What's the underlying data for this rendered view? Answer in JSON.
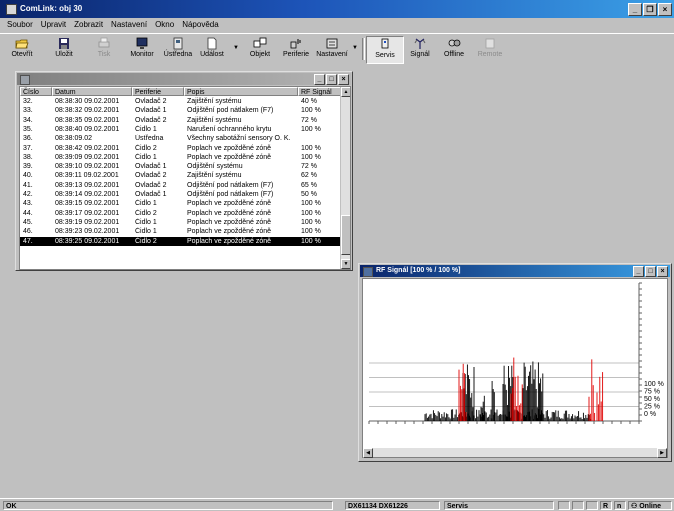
{
  "app": {
    "title": "ComLink: obj 30"
  },
  "menu": [
    "Soubor",
    "Upravit",
    "Zobrazit",
    "Nastavení",
    "Okno",
    "Nápověda"
  ],
  "toolbar": [
    {
      "label": "Otevřít",
      "icon": "folder-open-icon",
      "disabled": false
    },
    {
      "label": "Uložit",
      "icon": "floppy-disk-icon",
      "disabled": false
    },
    {
      "label": "Tisk",
      "icon": "printer-icon",
      "disabled": true
    },
    {
      "label": "Monitor",
      "icon": "monitor-icon",
      "disabled": false
    },
    {
      "label": "Ústředna",
      "icon": "control-panel-icon",
      "disabled": false
    },
    {
      "label": "Událost",
      "icon": "event-document-icon",
      "disabled": false
    },
    {
      "label": "Objekt",
      "icon": "object-icon",
      "disabled": false
    },
    {
      "label": "Periferie",
      "icon": "peripherals-icon",
      "disabled": false
    },
    {
      "label": "Nastavení",
      "icon": "settings-icon",
      "disabled": false
    },
    {
      "label": "Servis",
      "icon": "service-icon",
      "disabled": false,
      "pressed": true
    },
    {
      "label": "Signál",
      "icon": "antenna-signal-icon",
      "disabled": false
    },
    {
      "label": "Offline",
      "icon": "offline-icon",
      "disabled": false
    },
    {
      "label": "Remote",
      "icon": "remote-icon",
      "disabled": true
    }
  ],
  "events_window": {
    "columns": [
      "Číslo",
      "Datum",
      "Periferie",
      "Popis",
      "RF Signál"
    ],
    "rows": [
      [
        "32.",
        "08:38:30 09.02.2001",
        "Ovladač 2",
        "Zajištění systému",
        "40 %"
      ],
      [
        "33.",
        "08:38:32 09.02.2001",
        "Ovladač 1",
        "Odjištění pod nátlakem (F7)",
        "100 %"
      ],
      [
        "34.",
        "08:38:35 09.02.2001",
        "Ovladač 2",
        "Zajištění systému",
        "72 %"
      ],
      [
        "35.",
        "08:38:40 09.02.2001",
        "Čidlo 1",
        "Narušení ochranného krytu",
        "100 %"
      ],
      [
        "36.",
        "08:38:09.02",
        "Ústředna",
        "Všechny sabotážní sensory O. K.",
        ""
      ],
      [
        "37.",
        "08:38:42 09.02.2001",
        "Čidlo 2",
        "Poplach ve zpožděné zóně",
        "100 %"
      ],
      [
        "38.",
        "08:39:09 09.02.2001",
        "Čidlo 1",
        "Poplach ve zpožděné zóně",
        "100 %"
      ],
      [
        "39.",
        "08:39:10 09.02.2001",
        "Ovladač 1",
        "Odjištění systému",
        "72 %"
      ],
      [
        "40.",
        "08:39:11 09.02.2001",
        "Ovladač 2",
        "Zajištění systému",
        "62 %"
      ],
      [
        "41.",
        "08:39:13 09.02.2001",
        "Ovladač 2",
        "Odjištění pod nátlakem (F7)",
        "65 %"
      ],
      [
        "42.",
        "08:39:14 09.02.2001",
        "Ovladač 1",
        "Odjištění pod nátlakem (F7)",
        "50 %"
      ],
      [
        "43.",
        "08:39:15 09.02.2001",
        "Čidlo 1",
        "Poplach ve zpožděné zóně",
        "100 %"
      ],
      [
        "44.",
        "08:39:17 09.02.2001",
        "Čidlo 2",
        "Poplach ve zpožděné zóně",
        "100 %"
      ],
      [
        "45.",
        "08:39:19 09.02.2001",
        "Čidlo 1",
        "Poplach ve zpožděné zóně",
        "100 %"
      ],
      [
        "46.",
        "08:39:23 09.02.2001",
        "Čidlo 1",
        "Poplach ve zpožděné zóně",
        "100 %"
      ],
      [
        "47.",
        "08:39:25 09.02.2001",
        "Čidlo 2",
        "Poplach ve zpožděné zóně",
        "100 %"
      ]
    ],
    "selected_row": 15
  },
  "rf_window": {
    "title": "RF Signál [100 % / 100 %]",
    "scale_labels": [
      "100 %",
      "75 %",
      "50 %",
      "25 %",
      "0 %"
    ]
  },
  "chart_data": {
    "type": "bar",
    "y_ticks": [
      "100 %",
      "75 %",
      "50 %",
      "25 %",
      "0 %"
    ],
    "ylim": [
      0,
      100
    ],
    "series": [
      {
        "color": "#000000"
      },
      {
        "color": "#e00000"
      }
    ]
  },
  "statusbar": {
    "ready": "OK",
    "ports": "DX61134 DX61226",
    "mode": "Servis",
    "online": "Online"
  },
  "colors": {
    "title_start": "#0a246a",
    "title_end": "#3ba0e6",
    "desktop": "#c0c0c0"
  }
}
